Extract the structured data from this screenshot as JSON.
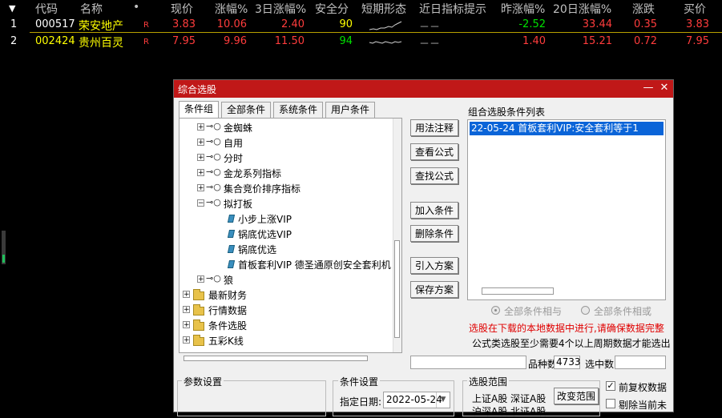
{
  "quote": {
    "menu_arrow": "▼",
    "columns": [
      "代码",
      "名称",
      "•",
      "现价",
      "涨幅%",
      "3日涨幅%",
      "安全分",
      "短期形态",
      "近日指标提示",
      "昨涨幅%",
      "20日涨幅%",
      "涨跌",
      "买价"
    ],
    "rows": [
      {
        "idx": "1",
        "code": "000517",
        "name": "荣安地产",
        "flag": "R",
        "price": "3.83",
        "chg_pct": "10.06",
        "chg3d": "2.40",
        "safety": "90",
        "hint": "－－",
        "prev_chg": "-2.52",
        "chg20d": "33.44",
        "change": "0.35",
        "bid": "3.83"
      },
      {
        "idx": "2",
        "code": "002424",
        "name": "贵州百灵",
        "flag": "R",
        "price": "7.95",
        "chg_pct": "9.96",
        "chg3d": "11.50",
        "safety": "94",
        "hint": "－－",
        "prev_chg": "1.40",
        "chg20d": "15.21",
        "change": "0.72",
        "bid": "7.95"
      }
    ]
  },
  "dialog": {
    "title": "综合选股",
    "minimize": "—",
    "close": "✕",
    "tabs": [
      "条件组",
      "全部条件",
      "系统条件",
      "用户条件"
    ],
    "tree": {
      "items": [
        {
          "label": "金蜘蛛"
        },
        {
          "label": "自用"
        },
        {
          "label": "分时"
        },
        {
          "label": "金龙系列指标"
        },
        {
          "label": "集合竞价排序指标"
        },
        {
          "label": "拟打板"
        }
      ],
      "children": [
        {
          "label": "小步上涨VIP"
        },
        {
          "label": "锅底优选VIP"
        },
        {
          "label": "锅底优选"
        },
        {
          "label": "首板套利VIP 德圣通原创安全套利机制"
        }
      ],
      "after": [
        {
          "label": "狼"
        }
      ],
      "folders": [
        {
          "label": "最新财务"
        },
        {
          "label": "行情数据"
        },
        {
          "label": "条件选股"
        },
        {
          "label": "五彩K线"
        }
      ]
    },
    "buttons": {
      "usage": "用法注释",
      "view_formula": "查看公式",
      "find_formula": "查找公式",
      "add_condition": "加入条件",
      "delete_condition": "删除条件",
      "import_plan": "引入方案",
      "save_plan": "保存方案"
    },
    "condition_list": {
      "title": "组合选股条件列表",
      "items": [
        "22-05-24 首板套利VIP:安全套利等于1"
      ]
    },
    "logic": {
      "and_label": "全部条件相与",
      "or_label": "全部条件相或"
    },
    "warning": "选股在下载的本地数据中进行,请确保数据完整",
    "formula_note": "公式类选股至少需要4个以上周期数据才能选出",
    "stats": {
      "count_label": "品种数",
      "count_value": "4733",
      "selected_label": "选中数",
      "selected_value": ""
    },
    "param_group": "参数设置",
    "cond_group": {
      "title": "条件设置",
      "date_label": "指定日期:",
      "date_value": "2022-05-24"
    },
    "range_group": {
      "title": "选股范围",
      "line1": "上证A股 深证A股",
      "line2": "沪深A股 北证A股",
      "change_button": "改变范围"
    },
    "checkboxes": {
      "forward_adjust": "前复权数据",
      "exclude_st": "剔除当前未"
    }
  }
}
